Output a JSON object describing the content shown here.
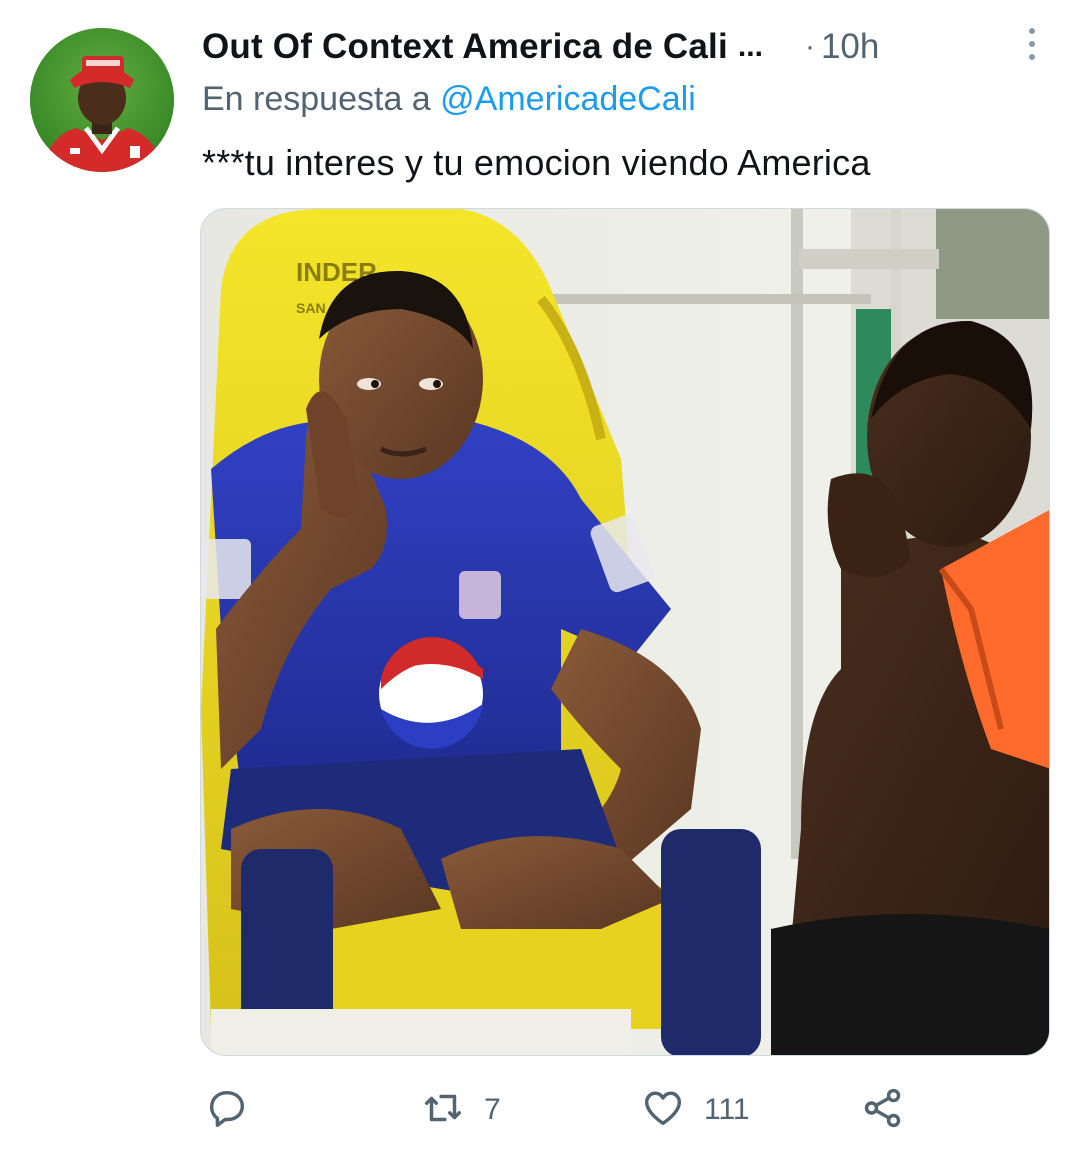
{
  "tweet": {
    "author": {
      "display_name": "Out Of Context America de Cali",
      "truncation": "...",
      "avatar_icon": "profile-avatar"
    },
    "time_separator": "·",
    "timestamp": "10h",
    "reply_prefix": "En respuesta a",
    "reply_handle": "@AmericadeCali",
    "text": "***tu interes y tu emocion viendo America",
    "media": {
      "kind": "photo",
      "visible_text": [
        "INDER",
        "SAN"
      ]
    },
    "actions": {
      "reply": {
        "icon": "comment-icon",
        "count": ""
      },
      "retweet": {
        "icon": "retweet-icon",
        "count": "7"
      },
      "like": {
        "icon": "heart-icon",
        "count": "111"
      },
      "share": {
        "icon": "share-icon"
      }
    },
    "colors": {
      "text_primary": "#0f1419",
      "text_secondary": "#536471",
      "link": "#1d9bf0",
      "icon": "#536471"
    }
  }
}
